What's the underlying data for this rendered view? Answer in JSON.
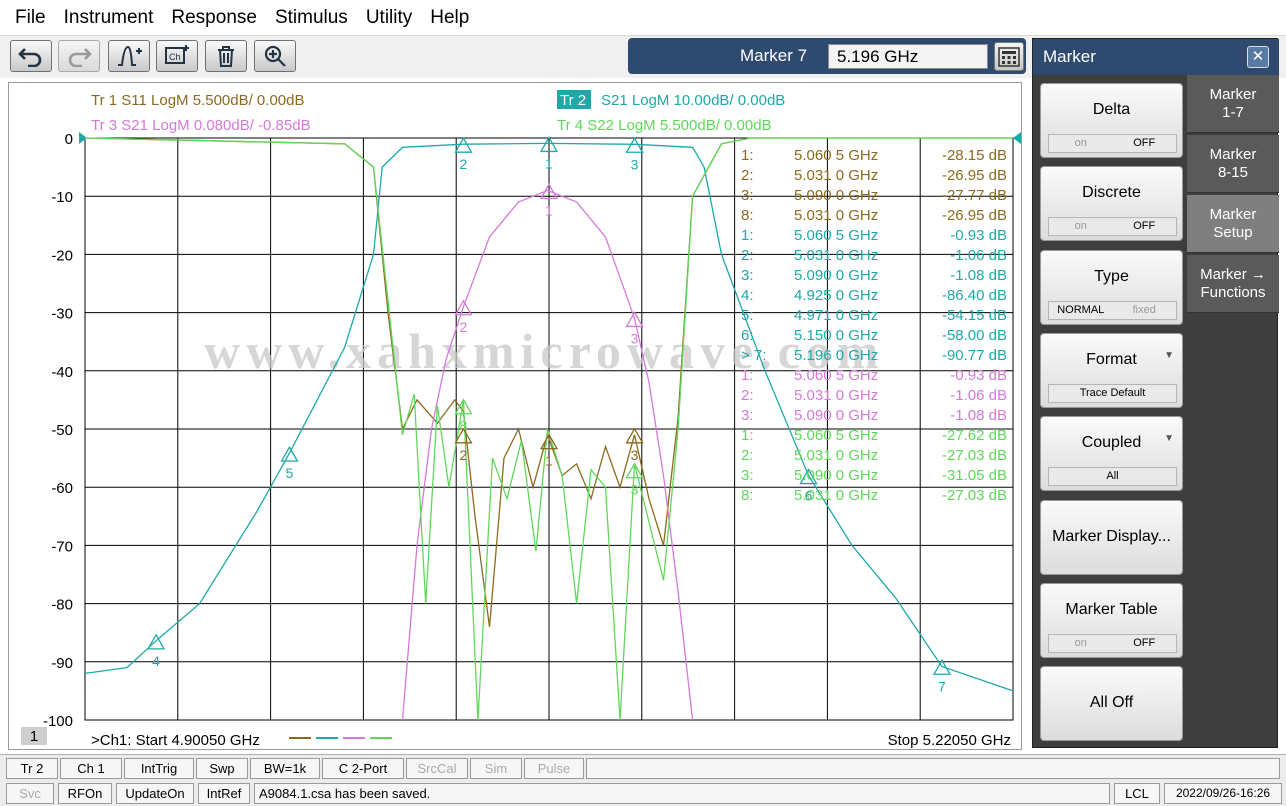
{
  "menu": [
    "File",
    "Instrument",
    "Response",
    "Stimulus",
    "Utility",
    "Help"
  ],
  "marker_entry": {
    "label": "Marker 7",
    "value": "5.196 GHz"
  },
  "channel_number": "1",
  "traces_header": [
    {
      "text": "Tr  1   S11 LogM 5.500dB/  0.00dB",
      "color": "#8a6a1e"
    },
    {
      "text": "S21 LogM 10.00dB/  0.00dB",
      "badge": "Tr  2",
      "color": "#1fa8a8"
    },
    {
      "text": "Tr  3   S21 LogM 0.080dB/  -0.85dB",
      "color": "#d47ad8"
    },
    {
      "text": "Tr  4   S22 LogM 5.500dB/  0.00dB",
      "color": "#5fd85a"
    }
  ],
  "y_ticks": [
    "0",
    "-10",
    "-20",
    "-30",
    "-40",
    "-50",
    "-60",
    "-70",
    "-80",
    "-90",
    "-100"
  ],
  "start_label": ">Ch1:  Start   4.90050 GHz",
  "stop_label": "Stop  5.22050 GHz",
  "watermark": "www.xahxmicrowave.com",
  "chart_data": {
    "type": "line",
    "x_range_ghz": [
      4.9005,
      5.2205
    ],
    "ylim": [
      -100,
      0
    ],
    "grid": true,
    "series": [
      {
        "name": "Tr 1 S11",
        "color": "#8a6a1e",
        "x": [
          4.9005,
          4.99,
          5.0,
          5.005,
          5.01,
          5.015,
          5.022,
          5.028,
          5.031,
          5.035,
          5.04,
          5.045,
          5.05,
          5.055,
          5.06,
          5.065,
          5.07,
          5.075,
          5.08,
          5.085,
          5.09,
          5.095,
          5.1,
          5.105,
          5.11,
          5.12,
          5.13,
          5.2205
        ],
        "y": [
          0,
          -1,
          -5,
          -30,
          -50,
          -45,
          -49,
          -45,
          -47,
          -65,
          -84,
          -55,
          -50,
          -60,
          -51,
          -58,
          -56,
          -62,
          -53,
          -60,
          -51,
          -62,
          -70,
          -48,
          -10,
          -1,
          0,
          0
        ]
      },
      {
        "name": "Tr 2 S21",
        "color": "#1fa8a8",
        "x": [
          4.9005,
          4.915,
          4.925,
          4.94,
          4.96,
          4.971,
          4.99,
          5.0,
          5.003,
          5.01,
          5.031,
          5.06,
          5.09,
          5.11,
          5.114,
          5.12,
          5.135,
          5.15,
          5.165,
          5.18,
          5.196,
          5.2205
        ],
        "y": [
          -92,
          -91,
          -86.4,
          -80,
          -64,
          -54.15,
          -36,
          -20,
          -5,
          -1.6,
          -1.06,
          -0.93,
          -1.08,
          -1.6,
          -5,
          -20,
          -40,
          -58,
          -70,
          -79,
          -90.8,
          -95
        ]
      },
      {
        "name": "Tr 3 S21",
        "color": "#d47ad8",
        "x": [
          5.01,
          5.015,
          5.02,
          5.025,
          5.031,
          5.04,
          5.05,
          5.06,
          5.07,
          5.08,
          5.09,
          5.095,
          5.1,
          5.105,
          5.11
        ],
        "y": [
          -100,
          -70,
          -50,
          -38,
          -29,
          -17,
          -11,
          -9,
          -11,
          -17,
          -31,
          -42,
          -58,
          -78,
          -100
        ]
      },
      {
        "name": "Tr 4 S22",
        "color": "#5fd85a",
        "x": [
          4.9005,
          4.99,
          5.0,
          5.005,
          5.01,
          5.014,
          5.018,
          5.022,
          5.026,
          5.031,
          5.036,
          5.041,
          5.046,
          5.051,
          5.056,
          5.06,
          5.065,
          5.07,
          5.075,
          5.08,
          5.085,
          5.09,
          5.095,
          5.1,
          5.105,
          5.11,
          5.12,
          5.13,
          5.2205
        ],
        "y": [
          0,
          -1,
          -5,
          -28,
          -51,
          -44,
          -80,
          -46,
          -60,
          -45,
          -100,
          -55,
          -62,
          -52,
          -71,
          -50,
          -58,
          -80,
          -57,
          -60,
          -100,
          -56,
          -66,
          -76,
          -50,
          -10,
          -1,
          0,
          0
        ]
      }
    ],
    "markers_table": [
      {
        "text": "1:",
        "freq": "5.060 5 GHz",
        "val": "-28.15 dB",
        "color": "#8a6a1e"
      },
      {
        "text": "2:",
        "freq": "5.031 0 GHz",
        "val": "-26.95 dB",
        "color": "#8a6a1e"
      },
      {
        "text": "3:",
        "freq": "5.090 0 GHz",
        "val": "-27.77 dB",
        "color": "#8a6a1e"
      },
      {
        "text": "8:",
        "freq": "5.031 0 GHz",
        "val": "-26.95 dB",
        "color": "#8a6a1e"
      },
      {
        "text": "1:",
        "freq": "5.060 5 GHz",
        "val": "-0.93 dB",
        "color": "#1fa8a8"
      },
      {
        "text": "2:",
        "freq": "5.031 0 GHz",
        "val": "-1.06 dB",
        "color": "#1fa8a8"
      },
      {
        "text": "3:",
        "freq": "5.090 0 GHz",
        "val": "-1.08 dB",
        "color": "#1fa8a8"
      },
      {
        "text": "4:",
        "freq": "4.925 0 GHz",
        "val": "-86.40 dB",
        "color": "#1fa8a8"
      },
      {
        "text": "5:",
        "freq": "4.971 0 GHz",
        "val": "-54.15 dB",
        "color": "#1fa8a8"
      },
      {
        "text": "6:",
        "freq": "5.150 0 GHz",
        "val": "-58.00 dB",
        "color": "#1fa8a8"
      },
      {
        "text": "> 7:",
        "freq": "5.196 0 GHz",
        "val": "-90.77 dB",
        "color": "#1fa8a8"
      },
      {
        "text": "1:",
        "freq": "5.060 5 GHz",
        "val": "-0.93 dB",
        "color": "#d47ad8"
      },
      {
        "text": "2:",
        "freq": "5.031 0 GHz",
        "val": "-1.06 dB",
        "color": "#d47ad8"
      },
      {
        "text": "3:",
        "freq": "5.090 0 GHz",
        "val": "-1.08 dB",
        "color": "#d47ad8"
      },
      {
        "text": "1:",
        "freq": "5.060 5 GHz",
        "val": "-27.62 dB",
        "color": "#5fd85a"
      },
      {
        "text": "2:",
        "freq": "5.031 0 GHz",
        "val": "-27.03 dB",
        "color": "#5fd85a"
      },
      {
        "text": "3:",
        "freq": "5.090 0 GHz",
        "val": "-31.05 dB",
        "color": "#5fd85a"
      },
      {
        "text": "8:",
        "freq": "5.031 0 GHz",
        "val": "-27.03 dB",
        "color": "#5fd85a"
      }
    ],
    "marker_flags": [
      {
        "label": "1",
        "freq": 5.0605,
        "db": -0.93,
        "color": "#1fa8a8"
      },
      {
        "label": "2",
        "freq": 5.031,
        "db": -1.06,
        "color": "#1fa8a8"
      },
      {
        "label": "3",
        "freq": 5.09,
        "db": -1.08,
        "color": "#1fa8a8"
      },
      {
        "label": "4",
        "freq": 4.925,
        "db": -86.4,
        "color": "#1fa8a8"
      },
      {
        "label": "5",
        "freq": 4.971,
        "db": -54.15,
        "color": "#1fa8a8"
      },
      {
        "label": "6",
        "freq": 5.15,
        "db": -58.0,
        "color": "#1fa8a8"
      },
      {
        "label": "7",
        "freq": 5.196,
        "db": -90.77,
        "color": "#1fa8a8"
      },
      {
        "label": "1",
        "freq": 5.0605,
        "db": -9,
        "color": "#d47ad8"
      },
      {
        "label": "2",
        "freq": 5.031,
        "db": -29,
        "color": "#d47ad8"
      },
      {
        "label": "3",
        "freq": 5.09,
        "db": -31,
        "color": "#d47ad8"
      },
      {
        "label": "8",
        "freq": 5.031,
        "db": -46,
        "color": "#5fd85a"
      },
      {
        "label": "2",
        "freq": 5.031,
        "db": -51,
        "color": "#8a6a1e"
      },
      {
        "label": "1",
        "freq": 5.0605,
        "db": -52,
        "color": "#8a6a1e"
      },
      {
        "label": "3",
        "freq": 5.09,
        "db": -51,
        "color": "#8a6a1e"
      },
      {
        "label": "3",
        "freq": 5.09,
        "db": -57,
        "color": "#5fd85a"
      }
    ]
  },
  "side_panel": {
    "title": "Marker",
    "softkeys": [
      {
        "label": "Delta",
        "toggle": [
          "on",
          "OFF"
        ],
        "active": 1
      },
      {
        "label": "Discrete",
        "toggle": [
          "on",
          "OFF"
        ],
        "active": 1
      },
      {
        "label": "Type",
        "toggle": [
          "NORMAL",
          "fixed"
        ],
        "active": 0
      },
      {
        "label": "Format",
        "caret": true,
        "single": "Trace Default"
      },
      {
        "label": "Coupled",
        "caret": true,
        "single": "All"
      },
      {
        "label": "Marker Display..."
      },
      {
        "label": "Marker Table",
        "toggle": [
          "on",
          "OFF"
        ],
        "active": 1
      },
      {
        "label": "All Off"
      }
    ],
    "tabs": [
      "Marker\n1-7",
      "Marker\n8-15",
      "Marker\nSetup",
      "Marker →\nFunctions"
    ],
    "active_tab": 2
  },
  "status1": [
    "Tr 2",
    "Ch 1",
    "IntTrig",
    "Swp",
    "BW=1k",
    "C  2-Port",
    "SrcCal",
    "Sim",
    "Pulse"
  ],
  "status2": [
    "Svc",
    "RFOn",
    "UpdateOn",
    "IntRef",
    "A9084.1.csa has been saved.",
    "LCL",
    "2022/09/26-16:26"
  ]
}
